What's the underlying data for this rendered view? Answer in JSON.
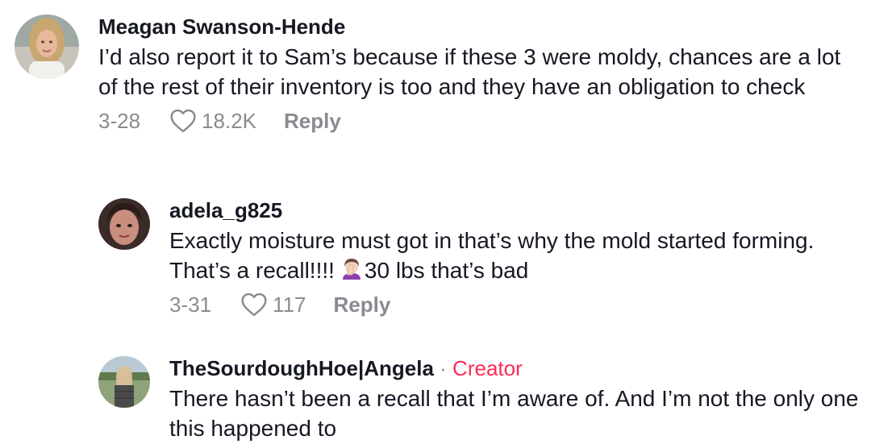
{
  "comments": [
    {
      "username": "Meagan Swanson-Hende",
      "text": "I’d also report it to Sam’s because if these 3 were moldy, chances are a lot of the rest of their inventory is too and they have an obligation to check",
      "date": "3-28",
      "likes": "18.2K",
      "reply_label": "Reply"
    },
    {
      "username": "adela_g825",
      "text_before_emoji": "Exactly moisture must got in that’s why the mold started forming. That’s a recall!!!!",
      "emoji": "woman-facepalming-emoji",
      "text_after_emoji": "30 lbs that’s bad",
      "date": "3-31",
      "likes": "117",
      "reply_label": "Reply"
    },
    {
      "username": "TheSourdoughHoe|Angela",
      "separator": " · ",
      "creator_badge": "Creator",
      "text": "There hasn’t been a recall that I’m aware of. And I’m not the only one this happened to"
    }
  ],
  "colors": {
    "text": "#161823",
    "muted": "#8a8b91",
    "creator": "#fe2c55"
  }
}
